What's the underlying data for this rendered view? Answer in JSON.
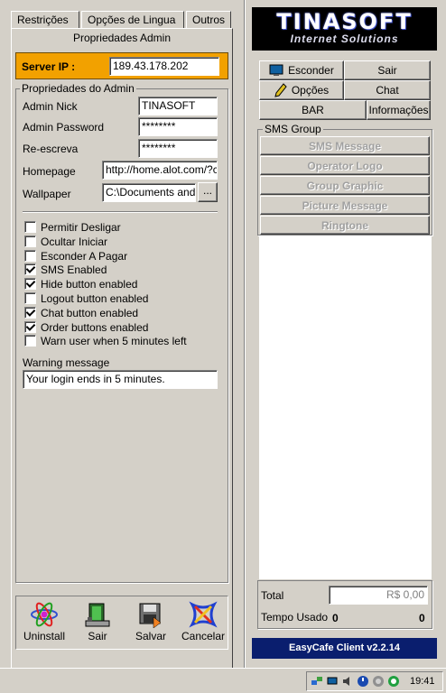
{
  "tabs": [
    "Restrições",
    "Opções de Lingua",
    "Outros"
  ],
  "left_panel": {
    "title": "Propriedades Admin",
    "server_ip_label": "Server IP :",
    "server_ip_value": "189.43.178.202",
    "group_title": "Propriedades do Admin",
    "fields": {
      "admin_nick_label": "Admin Nick",
      "admin_nick_value": "TINASOFT",
      "admin_password_label": "Admin Password",
      "admin_password_value": "********",
      "rewrite_label": "Re-escreva",
      "rewrite_value": "********",
      "homepage_label": "Homepage",
      "homepage_value": "http://home.alot.com/?c",
      "wallpaper_label": "Wallpaper",
      "wallpaper_value": "C:\\Documents and",
      "browse_label": "..."
    },
    "checkboxes": [
      {
        "label": "Permitir Desligar",
        "checked": false
      },
      {
        "label": "Ocultar Iniciar",
        "checked": false
      },
      {
        "label": "Esconder A Pagar",
        "checked": false
      },
      {
        "label": "SMS Enabled",
        "checked": true
      },
      {
        "label": "Hide button enabled",
        "checked": true
      },
      {
        "label": "Logout button enabled",
        "checked": false
      },
      {
        "label": "Chat button enabled",
        "checked": true
      },
      {
        "label": "Order buttons enabled",
        "checked": true
      },
      {
        "label": "Warn user when 5 minutes left",
        "checked": false
      }
    ],
    "warning_label": "Warning message",
    "warning_value": "Your login ends in 5 minutes.",
    "buttons": {
      "uninstall": "Uninstall",
      "exit": "Sair",
      "save": "Salvar",
      "cancel": "Cancelar"
    }
  },
  "right_panel": {
    "logo_line1": "TINASOFT",
    "logo_line2": "Internet Solutions",
    "nav": {
      "hide": "Esconder",
      "exit": "Sair",
      "options": "Opções",
      "chat": "Chat",
      "bar": "BAR",
      "info": "Informações"
    },
    "sms_group_title": "SMS Group",
    "sms_buttons": [
      "SMS Message",
      "Operator Logo",
      "Group Graphic",
      "Picture Message",
      "Ringtone"
    ],
    "total_label": "Total",
    "total_value": "R$ 0,00",
    "time_used_label": "Tempo Usado",
    "time_used_value_left": "0",
    "time_used_value_right": "0",
    "footer": "EasyCafe Client v2.2.14"
  },
  "taskbar": {
    "clock": "19:41"
  }
}
